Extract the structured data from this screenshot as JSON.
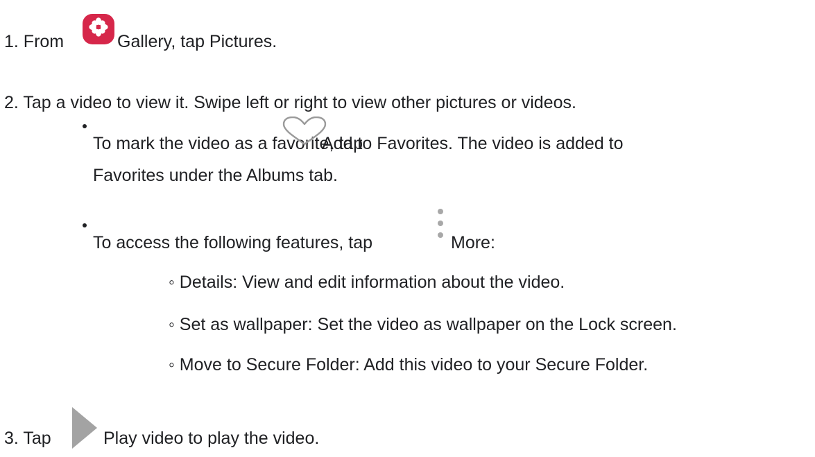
{
  "steps": {
    "s1": {
      "prefix": "1. From",
      "app_icon": "gallery-app-icon",
      "rest": "Gallery, tap Pictures."
    },
    "s2": {
      "text": "2. Tap a video to view it. Swipe left or right to view other pictures or videos."
    },
    "bullet1": {
      "pre": "To mark the video as a favorite, tap",
      "icon": "heart-icon",
      "post": "Add to Favorites. The video is added to",
      "cont": "Favorites under the Albums tab."
    },
    "bullet2": {
      "pre": "To access the following features, tap",
      "icon": "more-options-icon",
      "post": "More:"
    },
    "sub_items": [
      "◦ Details: View and edit information about the video.",
      "◦ Set as wallpaper: Set the video as wallpaper on the Lock screen.",
      "◦ Move to Secure Folder: Add this video to your Secure Folder."
    ],
    "s3": {
      "prefix": "3. Tap",
      "icon": "play-icon",
      "rest": "Play video to play the video."
    }
  },
  "colors": {
    "text": "#202124",
    "gallery_icon": "#d6274a",
    "heart_outline": "#9a9a9a",
    "more_dots": "#9a9a9a",
    "play_triangle": "#a3a3a3"
  }
}
